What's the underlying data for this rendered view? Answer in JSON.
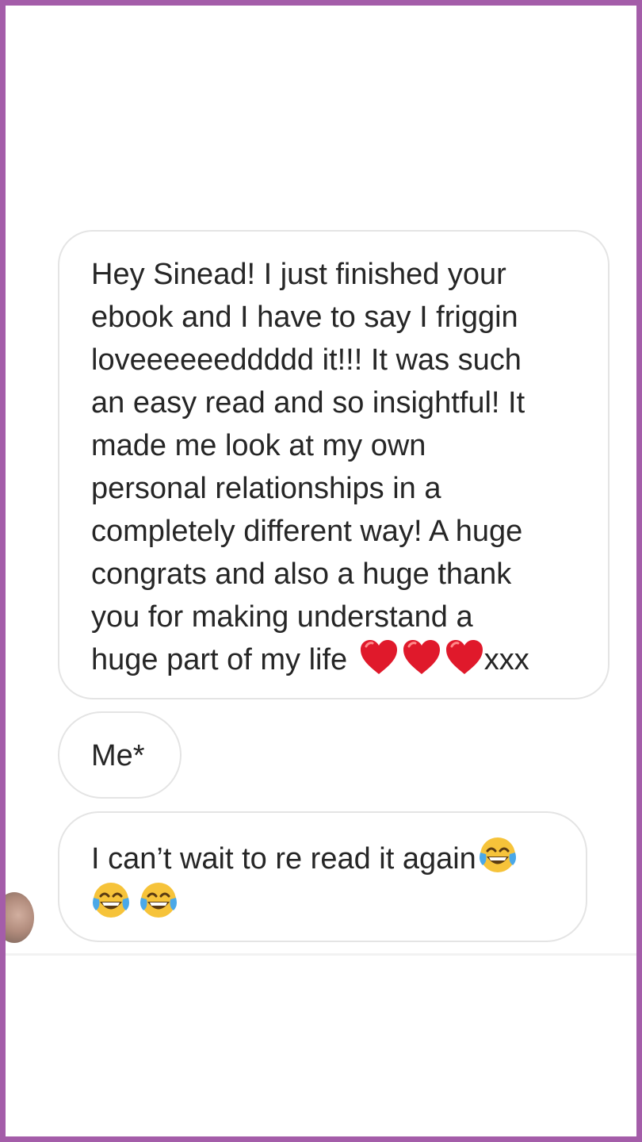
{
  "frame": {
    "border_color": "#a45da9",
    "background": "#ffffff"
  },
  "messages": [
    {
      "lines": [
        "Hey Sinead! I just finished your",
        "ebook and I have to say I friggin",
        "loveeeeeeddddd it!!! It was such",
        "an easy read and so insightful! It",
        "made me look at my own",
        "personal relationships in a",
        "completely different way! A huge",
        "congrats and also a huge thank",
        "you for making understand a"
      ],
      "last_line_text": "huge part of my life",
      "last_line_emojis": [
        "heart-emoji",
        "heart-emoji",
        "heart-emoji"
      ],
      "last_line_suffix": "xxx"
    },
    {
      "text": "Me*"
    },
    {
      "line_1_text": "I can’t wait to re read it again",
      "line_1_emojis": [
        "tears-of-joy-emoji"
      ],
      "line_2_emojis": [
        "tears-of-joy-emoji",
        "tears-of-joy-emoji"
      ]
    }
  ],
  "colors": {
    "text": "#262626",
    "bubble_border": "#e4e4e4",
    "heart": "#e0192b"
  }
}
